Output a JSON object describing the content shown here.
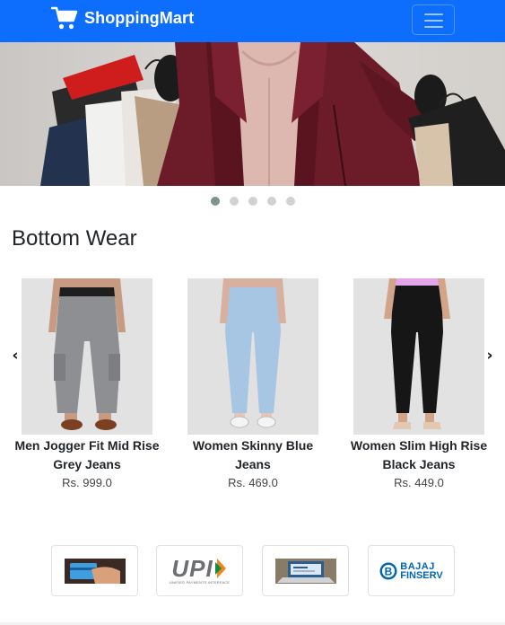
{
  "navbar": {
    "brand": "ShoppingMart",
    "brand_icon": "shopping-cart-icon",
    "toggler_icon": "hamburger-menu-icon",
    "background": "#0d6efd"
  },
  "carousel": {
    "slide_count": 5,
    "active_index": 0
  },
  "section": {
    "title": "Bottom Wear",
    "prev_glyph": "‹",
    "next_glyph": "›"
  },
  "products": [
    {
      "name": "Men Jogger Fit Mid Rise Grey Jeans",
      "price": "Rs. 999.0"
    },
    {
      "name": "Women Skinny Blue Jeans",
      "price": "Rs. 469.0"
    },
    {
      "name": "Women Slim High Rise Black Jeans",
      "price": "Rs. 449.0"
    }
  ],
  "payments": [
    {
      "name": "card-payment-icon"
    },
    {
      "name": "upi-logo",
      "text": "UPI",
      "subtext": "UNIFIED PAYMENTS INTERFACE"
    },
    {
      "name": "net-banking-icon"
    },
    {
      "name": "bajaj-finserv-logo",
      "text": "BAJAJ",
      "subtext": "FINSERV"
    }
  ]
}
